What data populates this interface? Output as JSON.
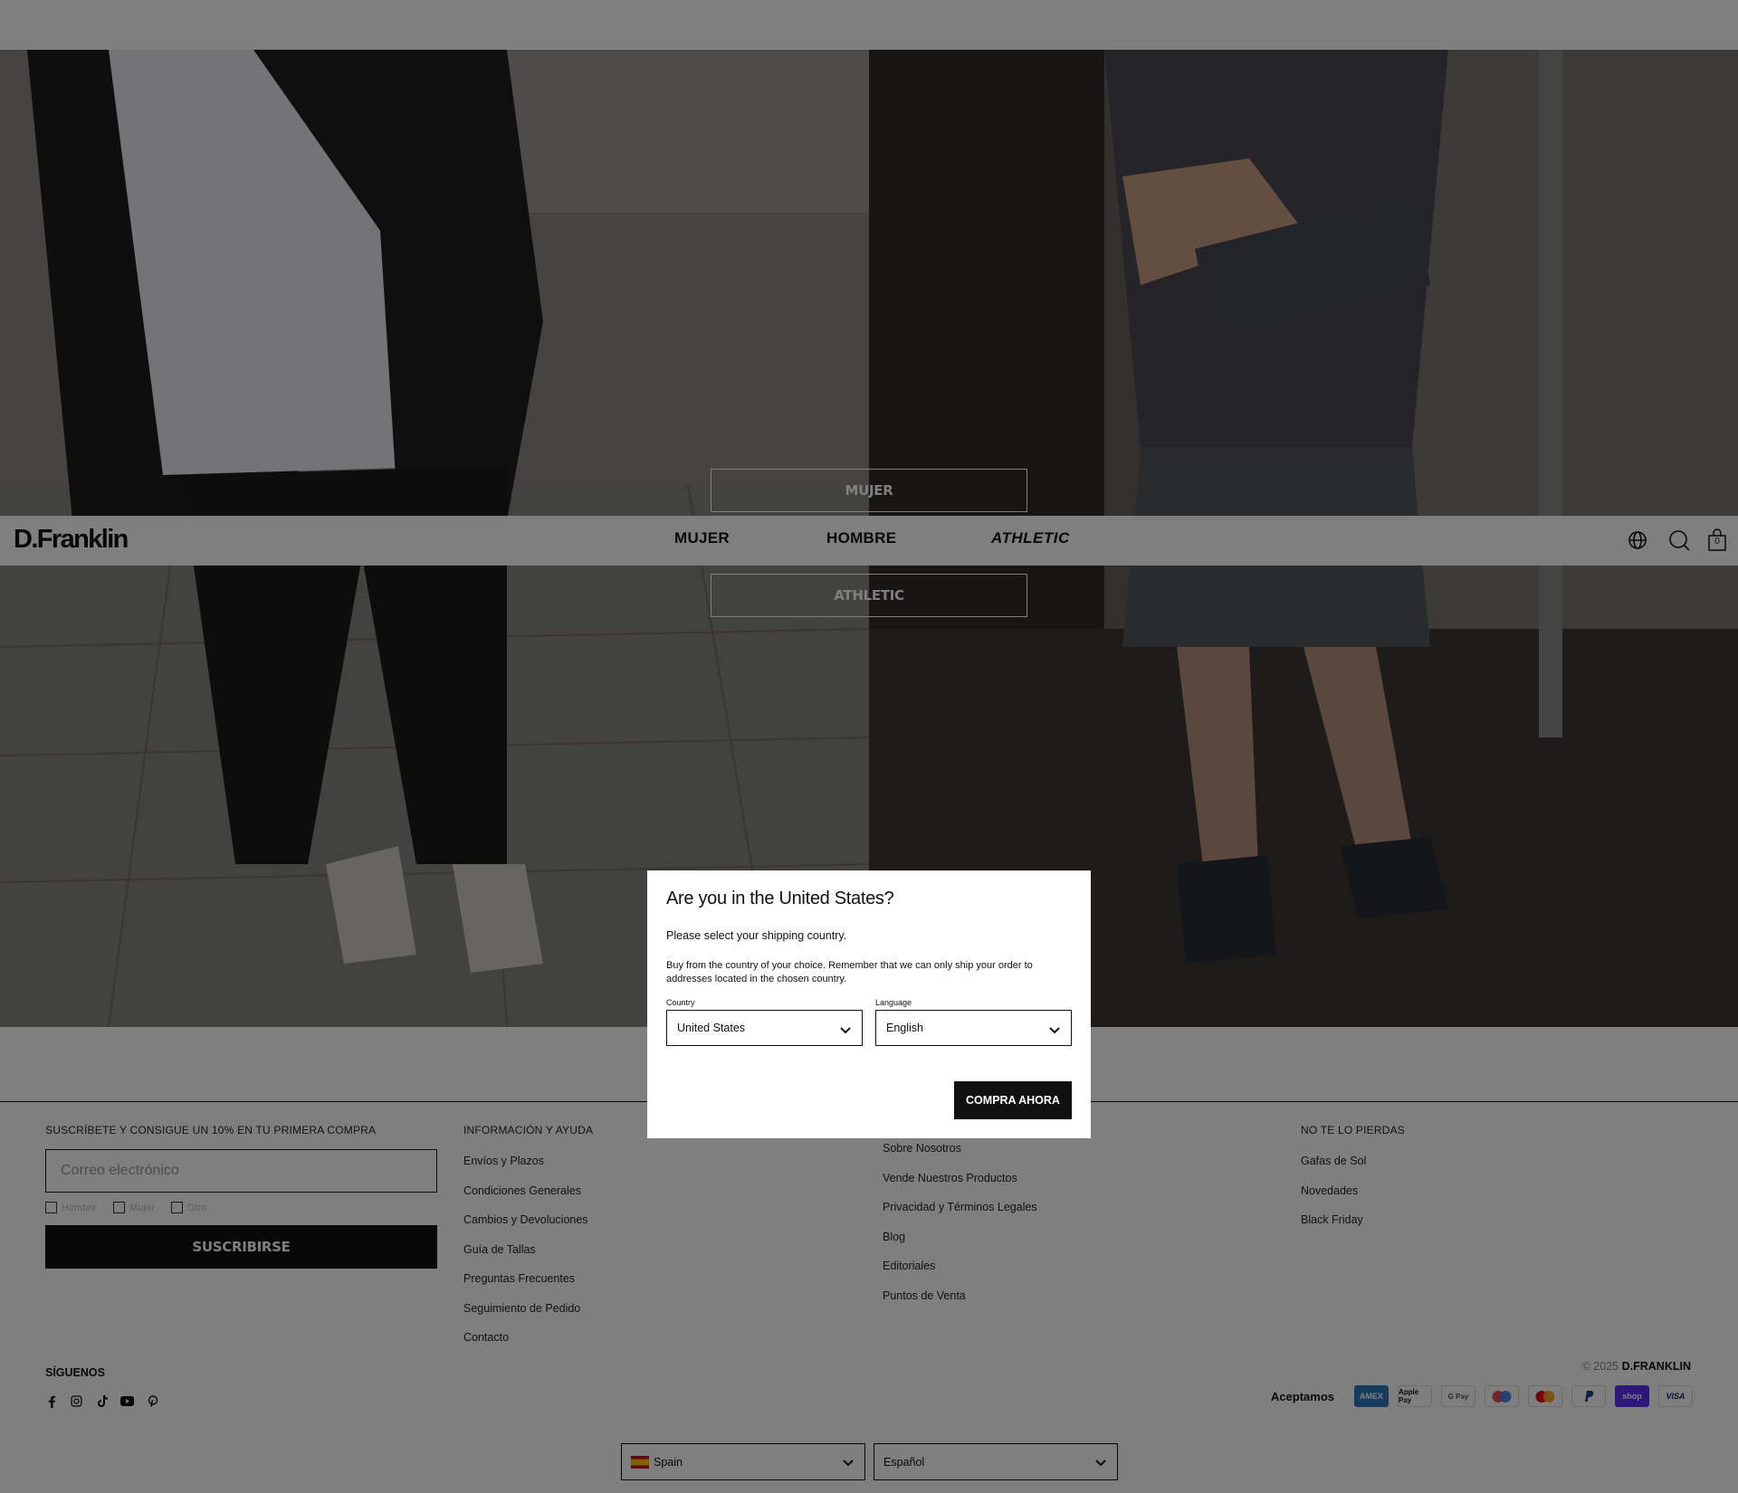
{
  "hero": {
    "buttons": [
      "MUJER",
      "ATHLETIC"
    ]
  },
  "header": {
    "logo": "D.Franklin",
    "nav": [
      "MUJER",
      "HOMBRE",
      "ATHLETIC"
    ],
    "cart_count": "0",
    "icons": [
      "globe-icon",
      "search-icon",
      "bag-icon"
    ]
  },
  "footer": {
    "newsletter": {
      "heading": "SUSCRÍBETE Y CONSIGUE UN 10% EN TU PRIMERA COMPRA",
      "placeholder": "Correo electrónico",
      "options": [
        "Hombre",
        "Mujer",
        "Otro"
      ],
      "button": "SUSCRIBIRSE"
    },
    "info": {
      "heading": "INFORMACIÓN Y AYUDA",
      "links": [
        "Envíos y Plazos",
        "Condiciones Generales",
        "Cambios y Devoluciones",
        "Guía de Tallas",
        "Preguntas Frecuentes",
        "Seguimiento de Pedido",
        "Contacto"
      ]
    },
    "about": {
      "heading": "",
      "links": [
        "Sobre Nosotros",
        "Vende Nuestros Productos",
        "Privacidad y Términos Legales",
        "Blog",
        "Editoriales",
        "Puntos de Venta"
      ]
    },
    "dontmiss": {
      "heading": "NO TE LO PIERDAS",
      "links": [
        "Gafas de Sol",
        "Novedades",
        "Black Friday"
      ]
    },
    "follow_label": "SÍGUENOS",
    "socials": [
      "facebook-icon",
      "instagram-icon",
      "tiktok-icon",
      "youtube-icon",
      "pinterest-icon"
    ],
    "copyright_prefix": "© 2025",
    "copyright_brand": "D.FRANKLIN",
    "pay_label": "Aceptamos",
    "payment_methods": [
      "AMEX",
      "Apple Pay",
      "G Pay",
      "Maestro",
      "Mastercard",
      "PayPal",
      "Shop Pay",
      "VISA"
    ],
    "country_select": "Spain",
    "language_select": "Español"
  },
  "modal": {
    "title": "Are you in the United States?",
    "subtitle": "Please select your shipping country.",
    "description": "Buy from the country of your choice. Remember that we can only ship your order to addresses located in the chosen country.",
    "country_label": "Country",
    "country_value": "United States",
    "language_label": "Language",
    "language_value": "English",
    "button": "COMPRA AHORA"
  },
  "colors": {
    "overlay": "#000000",
    "primary": "#111111",
    "shop_pay": "#5a31f4",
    "visa": "#1a1f71"
  }
}
